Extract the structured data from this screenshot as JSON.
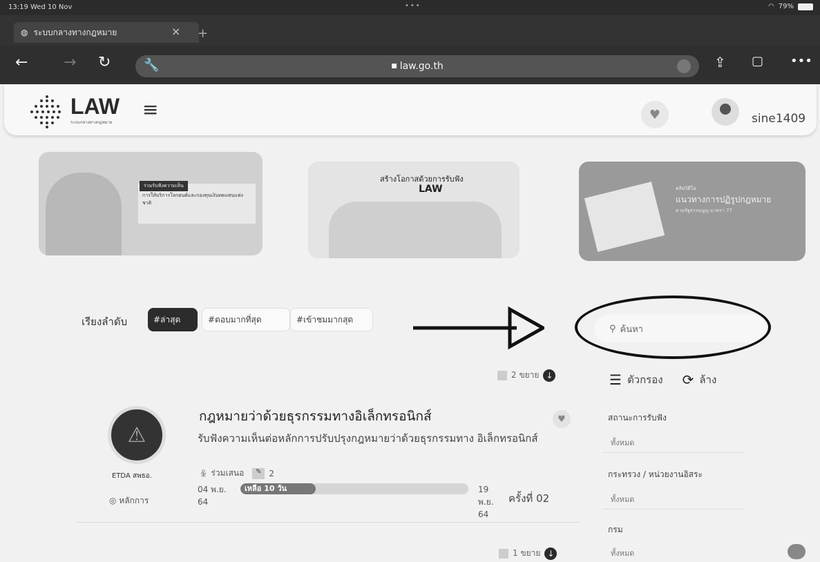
{
  "status_bar": {
    "time": "13:19  Wed 10 Nov",
    "battery": "79%"
  },
  "browser": {
    "tab_title": "ระบบกลางทางกฎหมาย",
    "url": "law.go.th"
  },
  "site": {
    "logo": "LAW",
    "logo_subtitle": "ระบบกลางทางกฎหมาย",
    "username": "sine1409"
  },
  "banners": {
    "b1_tag": "ร่วมรับฟังความเห็น",
    "b1_text": "การให้บริการโลกยนต์และกองทุนเงินทดแทนแห่งชาติ",
    "b2_title": "สร้างโอกาสด้วยการรับฟัง",
    "b2_logo": "LAW",
    "b3_small": "คลิปวิดีโอ",
    "b3_title": "แนวทางการปฏิรูปกฎหมาย",
    "b3_sub": "ตามรัฐธรรมนูญ มาตรา 77"
  },
  "sort": {
    "label": "เรียงลำดับ",
    "options": [
      "#ล่าสุด",
      "#ตอบมากที่สุด",
      "#เข้าชมมากสุด"
    ]
  },
  "search": {
    "placeholder": "ค้นหา"
  },
  "filters": {
    "filter_label": "ตัวกรอง",
    "clear_label": "ล้าง",
    "status_label": "สถานะการรับฟัง",
    "status_value": "ทั้งหมด",
    "ministry_label": "กระทรวง / หน่วยงานอิสระ",
    "ministry_value": "ทั้งหมด",
    "department_label": "กรม",
    "department_value": "ทั้งหมด"
  },
  "post": {
    "expand_top": "2 ขยาย",
    "title": "กฎหมายว่าด้วยธุรกรรมทางอิเล็กทรอนิกส์",
    "description": "รับฟังความเห็นต่อหลักการปรับปรุงกฎหมายว่าด้วยธุรกรรมทาง อิเล็กทรอนิกส์",
    "org": "ETDA สพธอ.",
    "tag": "หลักการ",
    "proposals_label": "ร่วมเสนอ",
    "proposals_count": "2",
    "start_date": "04 พ.ย. 64",
    "remaining": "เหลือ 10 วัน",
    "progress": 0.33,
    "end_date": "19 พ.ย. 64",
    "round": "ครั้งที่ 02",
    "expand_bottom": "1 ขยาย"
  },
  "colors": {
    "chrome_dark": "#2f2f2f",
    "chip_active": "#2c2c2c",
    "page_bg": "#f1f1f1"
  }
}
